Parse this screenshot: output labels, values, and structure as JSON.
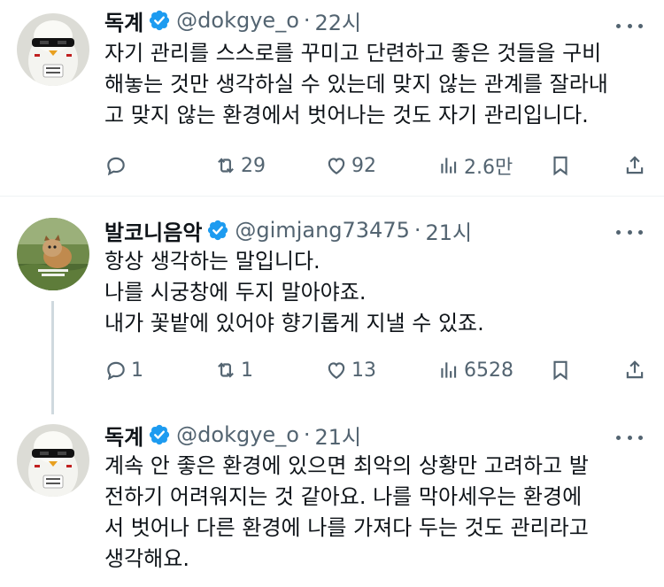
{
  "tweets": [
    {
      "name": "독계",
      "handle": "@dokgye_o",
      "time": "22시",
      "lines": [
        "자기 관리를 스스로를 꾸미고 단련하고 좋은 것들을 구비",
        "해놓는 것만 생각하실 수 있는데 맞지 않는 관계를 잘라내",
        "고 맞지 않는 환경에서 벗어나는 것도 자기 관리입니다."
      ],
      "replies": "",
      "retweets": "29",
      "likes": "92",
      "views": "2.6만"
    },
    {
      "name": "발코니음악",
      "handle": "@gimjang73475",
      "time": "21시",
      "lines": [
        "항상 생각하는 말입니다.",
        "나를 시궁창에 두지 말아야죠.",
        "내가 꽃밭에 있어야 향기롭게 지낼 수 있죠."
      ],
      "replies": "1",
      "retweets": "1",
      "likes": "13",
      "views": "6528"
    },
    {
      "name": "독계",
      "handle": "@dokgye_o",
      "time": "21시",
      "lines": [
        "계속 안 좋은 환경에 있으면 최악의 상황만 고려하고 발",
        "전하기 어려워지는 것 같아요. 나를 막아세우는 환경에",
        "서 벗어나 다른 환경에 나를 가져다 두는 것도 관리라고",
        "생각해요."
      ]
    }
  ],
  "separator": "·",
  "colors": {
    "text": "#0f1419",
    "secondary": "#536471",
    "verified": "#1d9bf0",
    "divider": "#eff3f4",
    "thread_line": "#cfd9de"
  }
}
